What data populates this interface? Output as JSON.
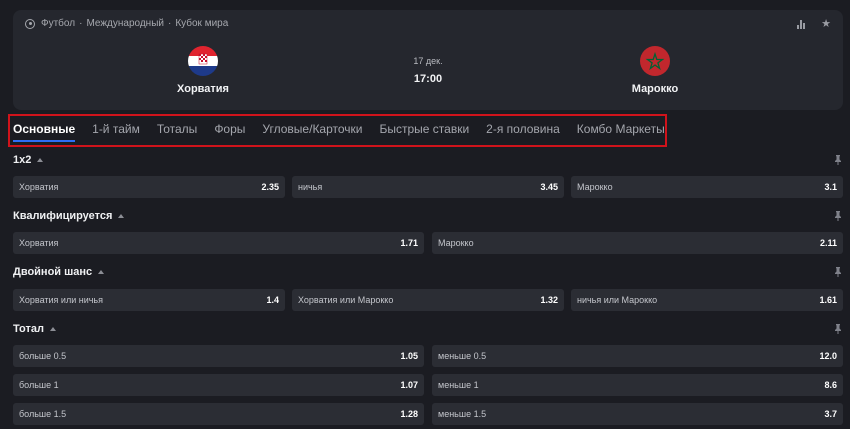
{
  "breadcrumb": {
    "sport": "Футбол",
    "region": "Международный",
    "league": "Кубок мира",
    "sep": "·"
  },
  "match": {
    "home": "Хорватия",
    "away": "Марокко",
    "date": "17 дек.",
    "time": "17:00"
  },
  "tabs": [
    "Основные",
    "1-й тайм",
    "Тоталы",
    "Форы",
    "Угловые/Карточки",
    "Быстрые ставки",
    "2-я половина",
    "Комбо Маркеты"
  ],
  "colors": {
    "active_tab_underline": "#2d6df6",
    "highlight_box": "#d0131b",
    "card_bg": "#25272e",
    "odd_bg": "#2b2d34"
  },
  "markets": {
    "m1x2": {
      "title": "1x2",
      "outcomes": [
        {
          "label": "Хорватия",
          "odd": "2.35"
        },
        {
          "label": "ничья",
          "odd": "3.45"
        },
        {
          "label": "Марокко",
          "odd": "3.1"
        }
      ]
    },
    "qualify": {
      "title": "Квалифицируется",
      "outcomes": [
        {
          "label": "Хорватия",
          "odd": "1.71"
        },
        {
          "label": "Марокко",
          "odd": "2.11"
        }
      ]
    },
    "double": {
      "title": "Двойной шанс",
      "outcomes": [
        {
          "label": "Хорватия или ничья",
          "odd": "1.4"
        },
        {
          "label": "Хорватия или Марокко",
          "odd": "1.32"
        },
        {
          "label": "ничья или Марокко",
          "odd": "1.61"
        }
      ]
    },
    "total": {
      "title": "Тотал",
      "rows": [
        [
          {
            "label": "больше 0.5",
            "odd": "1.05"
          },
          {
            "label": "меньше 0.5",
            "odd": "12.0"
          }
        ],
        [
          {
            "label": "больше 1",
            "odd": "1.07"
          },
          {
            "label": "меньше 1",
            "odd": "8.6"
          }
        ],
        [
          {
            "label": "больше 1.5",
            "odd": "1.28"
          },
          {
            "label": "меньше 1.5",
            "odd": "3.7"
          }
        ]
      ]
    }
  }
}
